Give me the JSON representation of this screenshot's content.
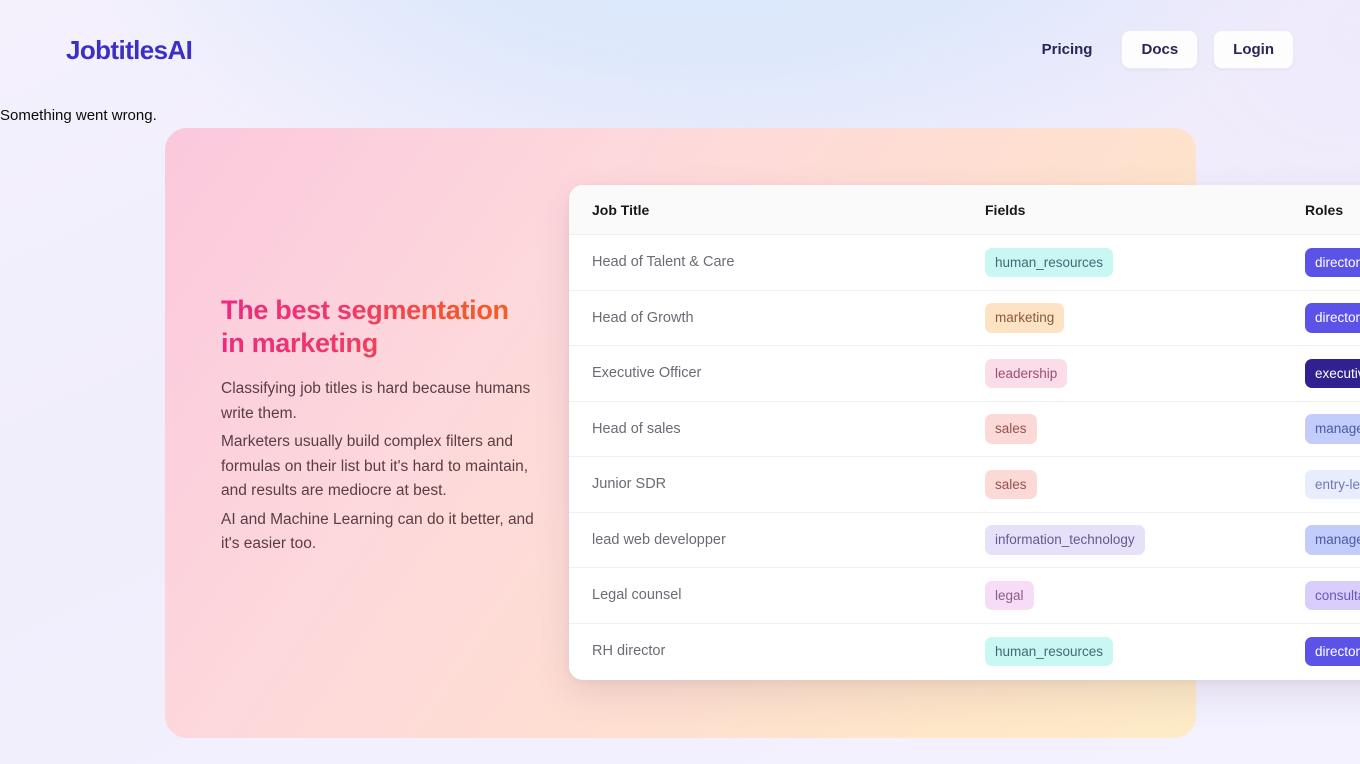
{
  "header": {
    "logo": "JobtitlesAI",
    "nav": {
      "pricing": "Pricing",
      "docs": "Docs",
      "login": "Login"
    }
  },
  "error_message": "Something went wrong.",
  "hero": {
    "title_line1": "The best segmentation",
    "title_line2": "in marketing",
    "paragraphs": [
      "Classifying job titles is hard because humans write them.",
      "Marketers usually build complex filters and formulas on their list but it's hard to maintain, and results are mediocre at best.",
      "AI and Machine Learning can do it better, and it's easier too."
    ]
  },
  "table": {
    "columns": {
      "job_title": "Job Title",
      "fields": "Fields",
      "roles": "Roles"
    },
    "rows": [
      {
        "job_title": "Head of Talent & Care",
        "field": "human_resources",
        "field_key": "human_resources",
        "role": "director",
        "role_key": "director"
      },
      {
        "job_title": "Head of Growth",
        "field": "marketing",
        "field_key": "marketing",
        "role": "director",
        "role_key": "director"
      },
      {
        "job_title": "Executive Officer",
        "field": "leadership",
        "field_key": "leadership",
        "role": "executive",
        "role_key": "executive"
      },
      {
        "job_title": "Head of sales",
        "field": "sales",
        "field_key": "sales",
        "role": "manager",
        "role_key": "manager"
      },
      {
        "job_title": "Junior SDR",
        "field": "sales",
        "field_key": "sales",
        "role": "entry-level",
        "role_key": "entry-level"
      },
      {
        "job_title": "lead web developper",
        "field": "information_technology",
        "field_key": "information_technology",
        "role": "manager",
        "role_key": "manager"
      },
      {
        "job_title": "Legal counsel",
        "field": "legal",
        "field_key": "legal",
        "role": "consultant",
        "role_key": "consultant"
      },
      {
        "job_title": "RH director",
        "field": "human_resources",
        "field_key": "human_resources",
        "role": "director",
        "role_key": "director"
      }
    ]
  },
  "colors": {
    "brand": "#3c2fc4",
    "title_gradient_start": "#ec2a7e",
    "title_gradient_end": "#f4651c",
    "role_director": "#5b53e8",
    "role_executive": "#312190",
    "role_manager": "#c2cdfb",
    "role_entry_level": "#e8ecfd",
    "role_consultant": "#d9cefb"
  }
}
